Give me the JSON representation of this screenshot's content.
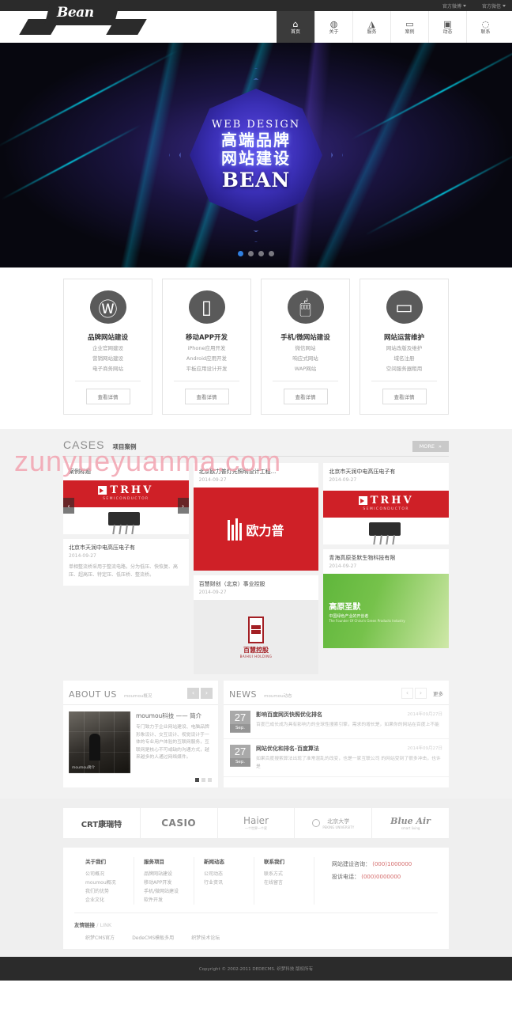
{
  "topbar": {
    "items": [
      {
        "label": "官方微博"
      },
      {
        "label": "官方微信"
      }
    ]
  },
  "header": {
    "logo": "Bean",
    "nav": [
      {
        "label": "首页",
        "icon": "home-icon",
        "glyph": "⌂",
        "active": true
      },
      {
        "label": "关于",
        "icon": "globe-icon",
        "glyph": "◍",
        "active": false
      },
      {
        "label": "服务",
        "icon": "cone-icon",
        "glyph": "◮",
        "active": false
      },
      {
        "label": "案例",
        "icon": "window-icon",
        "glyph": "▭",
        "active": false
      },
      {
        "label": "动态",
        "icon": "video-icon",
        "glyph": "▣",
        "active": false
      },
      {
        "label": "联系",
        "icon": "chat-icon",
        "glyph": "◌",
        "active": false
      }
    ]
  },
  "hero": {
    "eyebrow": "WEB DESIGN",
    "title_line1": "高端品牌",
    "title_line2": "网站建设",
    "brand": "BEAN",
    "slides": 4,
    "active_slide": 1
  },
  "services": [
    {
      "icon": "wordpress-icon",
      "glyph": "Ⓦ",
      "title": "品牌网站建设",
      "lines": [
        "企业官网建设",
        "营销网站建设",
        "电子商务网站"
      ],
      "button": "查看详情"
    },
    {
      "icon": "mobile-phone-icon",
      "glyph": "▯",
      "title": "移动APP开发",
      "lines": [
        "iPhone应用开发",
        "Android应用开发",
        "平板应用设计开发"
      ],
      "button": "查看详情"
    },
    {
      "icon": "mouse-icon",
      "glyph": "🖱",
      "title": "手机/微网站建设",
      "lines": [
        "微信网站",
        "响应式网站",
        "WAP网站"
      ],
      "button": "查看详情"
    },
    {
      "icon": "laptop-icon",
      "glyph": "▭",
      "title": "网站运营维护",
      "lines": [
        "网站改版及维护",
        "域名注册",
        "空间服务器租用"
      ],
      "button": "查看详情"
    }
  ],
  "cases": {
    "title_en": "CASES",
    "title_cn": "项目案例",
    "more": "MORE",
    "more_arrow": "»",
    "prev_arrow": "‹",
    "next_arrow": "›",
    "items": [
      {
        "title": "案例标题",
        "date": "",
        "image": "trhv-semiconductor-banner",
        "logo_main": "TRHV",
        "logo_sub": "SEMICONDUCTOR"
      },
      {
        "title": "北京欧力普灯光照明设计工程...",
        "date": "2014-09-27",
        "image": "oulipu-red-logo",
        "logo_main": "欧力普"
      },
      {
        "title": "北京市天润中电高压电子有",
        "date": "2014-09-27",
        "image": "trhv-semiconductor-banner",
        "logo_main": "TRHV",
        "logo_sub": "SEMICONDUCTOR"
      },
      {
        "title": "北京市天润中电高压电子有",
        "date": "2014-09-27",
        "excerpt": "单相整流桥采用于整流电路，分为低压、快恢复、高压、超高压、特定压、低压桥、整流桥。"
      },
      {
        "title": "百慧财创（北京）事业控股",
        "date": "2014-09-27",
        "image": "baihui-holding-logo",
        "logo_main": "百慧控股",
        "logo_sub": "BAIHUI HOLDING"
      },
      {
        "title": "青海高原圣默生物科技有限",
        "date": "2014-09-27",
        "image": "green-origin-banner",
        "banner_title": "高原圣默",
        "banner_sub": "中国绿色产业的开创者",
        "banner_en": "The Founder Of China's Green Products Industry"
      }
    ]
  },
  "about": {
    "title_en": "ABOUT US",
    "title_cn": "moumou概况",
    "prev_arrow": "‹",
    "next_arrow": "›",
    "image_caption": "moumou简介",
    "heading": "moumou科技 —— 简介",
    "paragraph": "专门致力于企业网站建设、电脑品牌形象设计、交互设计、视觉设计于一体的专业用户体验的互联网服务，互联网是核心不可或缺的沟通方式，越来越多的人通过网络媒件。",
    "dots": 3,
    "active_dot": 1
  },
  "news": {
    "title_en": "NEWS",
    "title_cn": "moumou动态",
    "prev_arrow": "‹",
    "next_arrow": "›",
    "more": "更多",
    "items": [
      {
        "day": "27",
        "month": "Sep.",
        "title": "影响百度网页快照优化排名",
        "date": "2014年09月27日",
        "excerpt": "百度已成长成为具有影响力的全球性搜索引擎，需求的增长是，如果你的网站在百度上不能"
      },
      {
        "day": "27",
        "month": "Sep.",
        "title": "网站优化和排名-百度算法",
        "date": "2014年09月27日",
        "excerpt": "如果百度搜索算法出现了准常混乱的改变，也是一家互联公司 的网站受到了很多冲击，也许是"
      }
    ]
  },
  "partners": [
    {
      "name": "CRT康瑞特",
      "sub": ""
    },
    {
      "name": "CASIO",
      "sub": ""
    },
    {
      "name": "Haier",
      "sub": "一个世界一个家"
    },
    {
      "name": "北京大学",
      "sub": "PEKING UNIVERSITY"
    },
    {
      "name": "Blue Air",
      "sub": "smart living"
    }
  ],
  "footer": {
    "columns": [
      {
        "title": "关于我们",
        "links": [
          "公司概况",
          "moumou概况",
          "我们的优势",
          "企业文化"
        ]
      },
      {
        "title": "服务项目",
        "links": [
          "品牌网站建设",
          "移动APP开发",
          "手机/微网站建设",
          "软件开发"
        ]
      },
      {
        "title": "新闻动态",
        "links": [
          "公司动态",
          "行业资讯"
        ]
      },
      {
        "title": "联系我们",
        "links": [
          "联系方式",
          "在线留言"
        ]
      }
    ],
    "phones": [
      {
        "label": "网站建设咨询：",
        "value": "(000)1000000"
      },
      {
        "label": "投诉电话：",
        "value": "(000)0000000"
      }
    ],
    "links_title": "友情链接",
    "links_en": "/ LINK",
    "friend_links": [
      "织梦CMS官方",
      "DedeCMS模板多用",
      "织梦技术论坛"
    ],
    "copyright": "Copyright © 2002-2011 DEDECMS. 织梦科技 版权所有"
  },
  "watermark": "zunyueyuanma.com",
  "colors": {
    "accent": "#cf2027",
    "dark": "#2b2b2b",
    "muted": "#9a9a9a",
    "phone": "#d46a6a"
  }
}
